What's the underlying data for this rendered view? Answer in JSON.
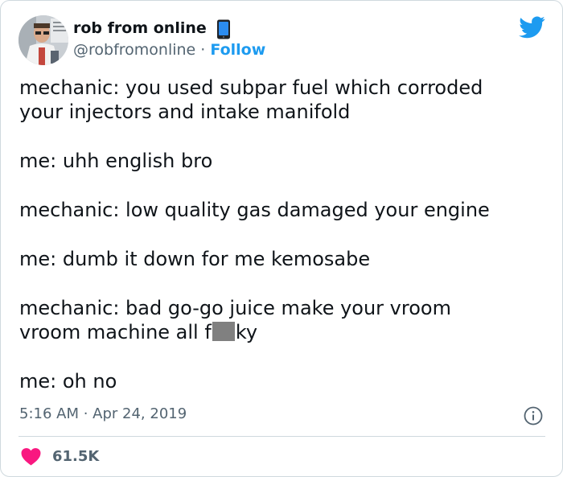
{
  "user": {
    "display_name": "rob from online",
    "handle": "@robfromonline",
    "separator": " · ",
    "follow_label": "Follow"
  },
  "tweet": {
    "line1a": "mechanic: you used subpar fuel which corroded",
    "line1b": "your injectors and intake manifold",
    "line2": "me: uhh english bro",
    "line3": "mechanic: low quality gas damaged your engine",
    "line4": "me: dumb it down for me kemosabe",
    "line5a": "mechanic: bad go-go juice make your vroom",
    "line5b_prefix": "vroom machine all f",
    "line5b_suffix": "ky",
    "line6": "me: oh no"
  },
  "meta": {
    "timestamp": "5:16 AM · Apr 24, 2019",
    "likes": "61.5K"
  },
  "colors": {
    "brand": "#1d9bf0",
    "heart": "#f91880",
    "muted": "#536471",
    "redaction": "#808080"
  },
  "icons": {
    "brand": "twitter-bird-icon",
    "emoji": "mobile-phone-icon",
    "info": "info-icon",
    "like": "heart-icon"
  }
}
